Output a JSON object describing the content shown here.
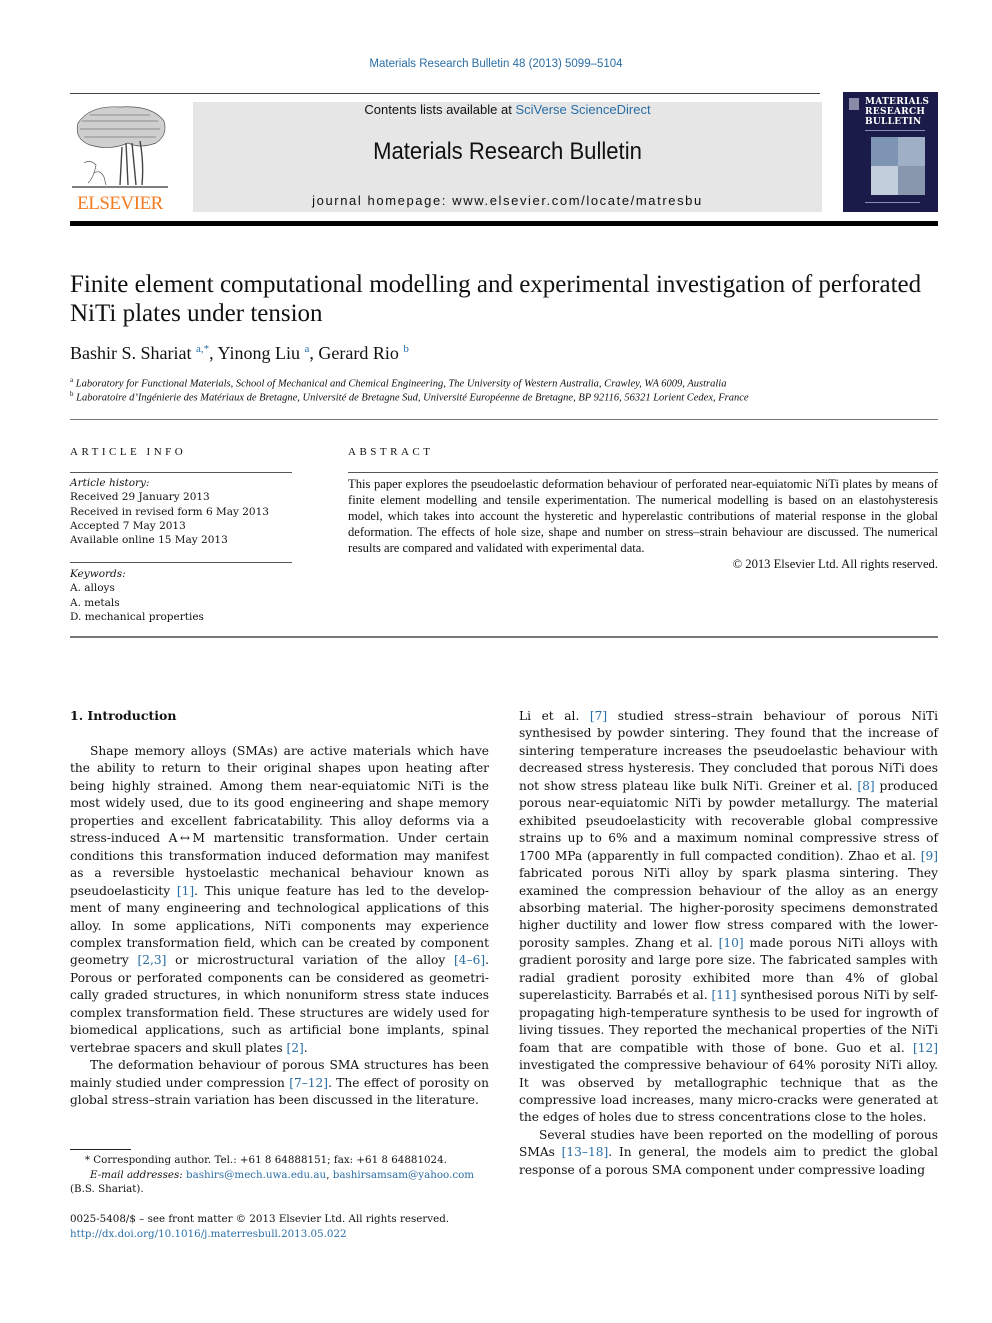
{
  "header": {
    "journal_reference": "Materials Research Bulletin 48 (2013) 5099–5104",
    "contents_prefix": "Contents lists available at ",
    "contents_link": "SciVerse ScienceDirect",
    "journal_title": "Materials Research Bulletin",
    "homepage_label": "journal homepage: ",
    "homepage_url": "www.elsevier.com/locate/matresbu",
    "publisher_logo_text": "ELSEVIER",
    "publisher_logo_color": "#f47b20",
    "cover_title_lines": [
      "MATERIALS",
      "RESEARCH",
      "BULLETIN"
    ],
    "link_color": "#2a6ea6"
  },
  "article": {
    "title": "Finite element computational modelling and experimental investigation of perforated NiTi plates under tension",
    "authors": [
      {
        "name": "Bashir S. Shariat",
        "sup": "a,*"
      },
      {
        "name": "Yinong Liu",
        "sup": "a"
      },
      {
        "name": "Gerard Rio",
        "sup": "b"
      }
    ],
    "affiliations": [
      {
        "key": "a",
        "text": "Laboratory for Functional Materials, School of Mechanical and Chemical Engineering, The University of Western Australia, Crawley, WA 6009, Australia"
      },
      {
        "key": "b",
        "text": "Laboratoire d’Ingénierie des Matériaux de Bretagne, Université de Bretagne Sud, Université Européenne de Bretagne, BP 92116, 56321 Lorient Cedex, France"
      }
    ]
  },
  "article_info": {
    "heading": "ARTICLE INFO",
    "history_label": "Article history:",
    "history": [
      "Received 29 January 2013",
      "Received in revised form 6 May 2013",
      "Accepted 7 May 2013",
      "Available online 15 May 2013"
    ],
    "keywords_label": "Keywords:",
    "keywords": [
      "A. alloys",
      "A. metals",
      "D. mechanical properties"
    ]
  },
  "abstract": {
    "heading": "ABSTRACT",
    "text": "This paper explores the pseudoelastic deformation behaviour of perforated near-equiatomic NiTi plates by means of finite element modelling and tensile experimentation. The numerical modelling is based on an elastohysteresis model, which takes into account the hysteretic and hyperelastic contributions of material response in the global deformation. The effects of hole size, shape and number on stress–strain behaviour are discussed. The numerical results are compared and validated with experimental data.",
    "copyright": "© 2013 Elsevier Ltd. All rights reserved."
  },
  "body": {
    "section_heading": "1.  Introduction",
    "left_paragraphs": [
      [
        {
          "t": "Shape memory alloys (SMAs) are active materials which have the ability to return to their original shapes upon heating after being highly strained. Among them near-equiatomic NiTi is the most widely used, due to its good engineering and shape memory properties and excellent fabricatability. This alloy deforms via a stress-induced A ↔ M martensitic transformation. Under certain conditions this transformation induced deformation may manifest as a reversible hystoelastic mechanical behaviour known as pseudoelasticity "
        },
        {
          "ref": "[1]"
        },
        {
          "t": ". This unique feature has led to the develop­ment of many engineering and technological applications of this alloy. In some applications, NiTi components may experience complex transformation field, which can be created by component geometry "
        },
        {
          "ref": "[2,3]"
        },
        {
          "t": " or microstructural variation of the alloy "
        },
        {
          "ref": "[4–6]"
        },
        {
          "t": ". Porous or perforated components can be considered as geometri­cally graded structures, in which nonuniform stress state induces complex transformation field. These structures are widely used for biomedical applications, such as artificial bone implants, spinal vertebrae spacers and skull plates "
        },
        {
          "ref": "[2]"
        },
        {
          "t": "."
        }
      ],
      [
        {
          "t": "The deformation behaviour of porous SMA structures has been mainly studied under compression "
        },
        {
          "ref": "[7–12]"
        },
        {
          "t": ". The effect of porosity on global stress–strain variation has been discussed in the literature."
        }
      ]
    ],
    "right_paragraphs": [
      [
        {
          "t": "Li et al. "
        },
        {
          "ref": "[7]"
        },
        {
          "t": " studied stress–strain behaviour of porous NiTi synthesised by powder sintering. They found that the increase of sintering temperature increases the pseudoelastic behaviour with decreased stress hysteresis. They concluded that porous NiTi does not show stress plateau like bulk NiTi. Greiner et al. "
        },
        {
          "ref": "[8]"
        },
        {
          "t": " produced porous near-equiatomic NiTi by powder metallurgy. The material exhibited pseudoelasticity with recoverable global compressive strains up to 6% and a maximum nominal compres­sive stress of 1700 MPa (apparently in full compacted condition). Zhao et al. "
        },
        {
          "ref": "[9]"
        },
        {
          "t": " fabricated porous NiTi alloy by spark plasma sintering. They examined the compression behaviour of the alloy as an energy absorbing material. The higher-porosity specimens demonstrated higher ductility and lower flow stress compared with the lower-porosity samples. Zhang et al. "
        },
        {
          "ref": "[10]"
        },
        {
          "t": " made porous NiTi alloys with gradient porosity and large pore size. The fabricated samples with radial gradient porosity exhibited more than 4% of global superelasticity. Barrabés et al. "
        },
        {
          "ref": "[11]"
        },
        {
          "t": " synthesised porous NiTi by self-propagating high-temperature synthesis to be used for ingrowth of living tissues. They reported the mechanical properties of the NiTi foam that are compatible with those of bone. Guo et al. "
        },
        {
          "ref": "[12]"
        },
        {
          "t": " investigated the compressive behaviour of 64% porosity NiTi alloy. It was observed by metallographic technique that as the compressive load increases, many micro-cracks were generated at the edges of holes due to stress concentrations close to the holes."
        }
      ],
      [
        {
          "t": "Several studies have been reported on the modelling of porous SMAs "
        },
        {
          "ref": "[13–18]"
        },
        {
          "t": ". In general, the models aim to predict the global response of a porous SMA component under compressive loading"
        }
      ]
    ]
  },
  "footnote": {
    "star": "*",
    "corresponding": "Corresponding author. Tel.: +61 8 64888151; fax: +61 8 64881024.",
    "email_label": "E-mail addresses:",
    "emails": [
      "bashirs@mech.uwa.edu.au",
      "bashirsamsam@yahoo.com"
    ],
    "owner": "(B.S. Shariat)."
  },
  "front_matter": {
    "issn_line": "0025-5408/$ – see front matter © 2013 Elsevier Ltd. All rights reserved.",
    "doi": "http://dx.doi.org/10.1016/j.materresbull.2013.05.022"
  }
}
